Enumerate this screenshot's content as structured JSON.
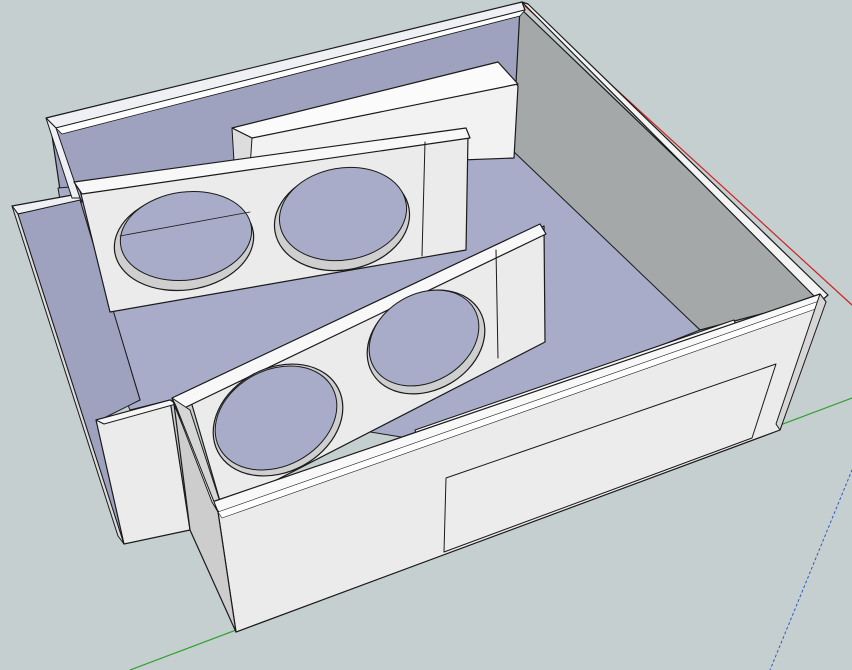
{
  "scene": {
    "background_color": "#c5cfcf",
    "floor_color": "#a8acc8",
    "inner_wall_color": "#9ea2bf",
    "right_inner_wall_color": "#a4a8a8",
    "outer_panel_color": "#eaeaea",
    "top_edge_color": "#f2f2f2",
    "side_face_color": "#cdcdcd",
    "outline_color": "#1a1a1a",
    "axes": {
      "green_axis_color": "#2aa02a",
      "red_axis_color": "#cc2222",
      "blue_axis_color": "#3355cc"
    },
    "objects": [
      {
        "name": "enclosure-box",
        "kind": "open subwoofer box"
      },
      {
        "name": "back-baffle",
        "kind": "ported baffle with 2 driver holes"
      },
      {
        "name": "front-baffle",
        "kind": "ported baffle with 2 driver holes"
      },
      {
        "name": "back-brace",
        "kind": "rectangular brace block"
      },
      {
        "name": "floor-strip",
        "kind": "flat support strip"
      }
    ]
  }
}
